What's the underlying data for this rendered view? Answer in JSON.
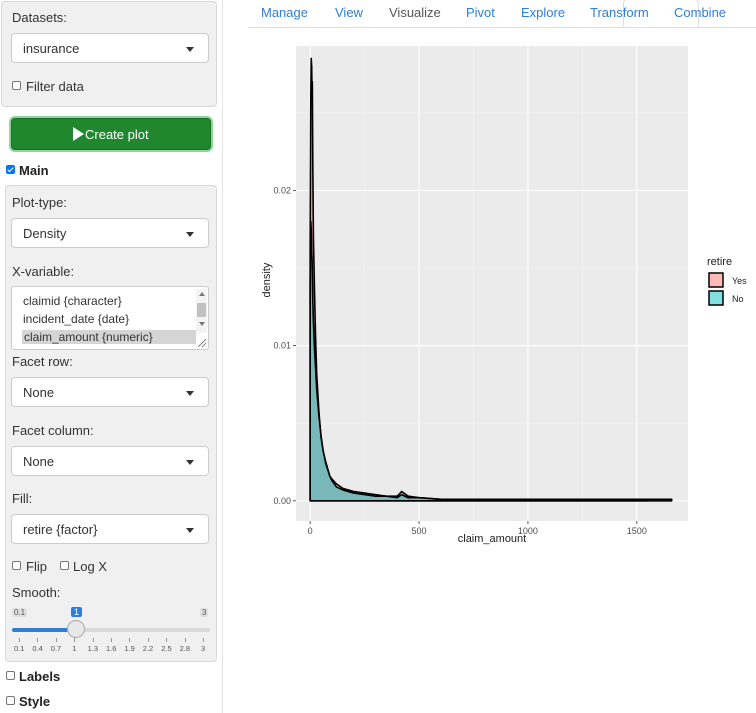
{
  "sidebar": {
    "datasets_label": "Datasets:",
    "dataset_value": "insurance",
    "filter_label": "Filter data",
    "create_plot_label": "Create plot",
    "main_label": "Main",
    "plot_type_label": "Plot-type:",
    "plot_type_value": "Density",
    "xvar_label": "X-variable:",
    "xvar_options": [
      "claimid {character}",
      "incident_date {date}",
      "claim_amount {numeric}"
    ],
    "xvar_selected": "claim_amount {numeric}",
    "facet_row_label": "Facet row:",
    "facet_row_value": "None",
    "facet_col_label": "Facet column:",
    "facet_col_value": "None",
    "fill_label": "Fill:",
    "fill_value": "retire {factor}",
    "flip_label": "Flip",
    "logx_label": "Log X",
    "smooth_label": "Smooth:",
    "smooth_min": "0.1",
    "smooth_max": "3",
    "smooth_value": "1",
    "smooth_ticks": [
      "0.1",
      "0.4",
      "0.7",
      "1",
      "1.3",
      "1.6",
      "1.9",
      "2.2",
      "2.5",
      "2.8",
      "3"
    ],
    "labels_label": "Labels",
    "style_label": "Style"
  },
  "tabs": [
    "Manage",
    "View",
    "Visualize",
    "Pivot",
    "Explore",
    "Transform",
    "Combine"
  ],
  "active_tab": "Visualize",
  "chart_data": {
    "type": "area",
    "xlabel": "claim_amount",
    "ylabel": "density",
    "xlim": [
      -65,
      1735
    ],
    "ylim": [
      -0.0013,
      0.0293
    ],
    "x_ticks": [
      0,
      500,
      1000,
      1500
    ],
    "y_ticks": [
      0.0,
      0.01,
      0.02
    ],
    "y_tick_labels": [
      "0.00",
      "0.01",
      "0.02"
    ],
    "legend_title": "retire",
    "legend_position": "right",
    "grid": true,
    "panel_color": "#ebebeb",
    "series": [
      {
        "name": "Yes",
        "color": "#f8766d",
        "x": [
          0,
          3,
          5,
          7,
          9,
          10,
          12,
          15,
          20,
          25,
          30,
          40,
          50,
          60,
          70,
          80,
          90,
          100,
          120,
          150,
          200,
          250,
          300,
          350,
          400,
          420,
          450,
          500,
          600,
          700,
          800,
          900,
          1000,
          1100,
          1200,
          1300,
          1400,
          1500,
          1550
        ],
        "y": [
          0.016,
          0.026,
          0.0285,
          0.028,
          0.026,
          0.027,
          0.022,
          0.017,
          0.0135,
          0.0105,
          0.0082,
          0.0058,
          0.004,
          0.0032,
          0.0024,
          0.002,
          0.0016,
          0.0014,
          0.0011,
          0.0008,
          0.0006,
          0.0005,
          0.0004,
          0.0003,
          0.0003,
          0.0006,
          0.0003,
          0.0002,
          0.0001,
          0.0001,
          0.0001,
          0.0001,
          0.0001,
          0.0001,
          0.0001,
          0.0001,
          0.0001,
          0.0001,
          0.0001
        ]
      },
      {
        "name": "No",
        "color": "#00bfc4",
        "x": [
          0,
          3,
          5,
          7,
          9,
          10,
          12,
          15,
          20,
          25,
          30,
          40,
          50,
          60,
          70,
          80,
          90,
          100,
          120,
          150,
          200,
          250,
          300,
          350,
          400,
          420,
          450,
          500,
          600,
          700,
          800,
          900,
          1000,
          1100,
          1200,
          1300,
          1400,
          1500,
          1600,
          1660
        ],
        "y": [
          0.014,
          0.018,
          0.0175,
          0.016,
          0.0155,
          0.0145,
          0.013,
          0.0115,
          0.0098,
          0.0085,
          0.0072,
          0.0055,
          0.0042,
          0.0032,
          0.0026,
          0.0021,
          0.0016,
          0.0013,
          0.0009,
          0.0007,
          0.0005,
          0.0004,
          0.0003,
          0.0003,
          0.0002,
          0.0004,
          0.0002,
          0.0002,
          0.0001,
          0.0001,
          0.0001,
          0.0001,
          0.0001,
          0.0001,
          0.0001,
          0.0001,
          0.0001,
          0.0001,
          0.0001,
          0.0001
        ]
      }
    ]
  }
}
